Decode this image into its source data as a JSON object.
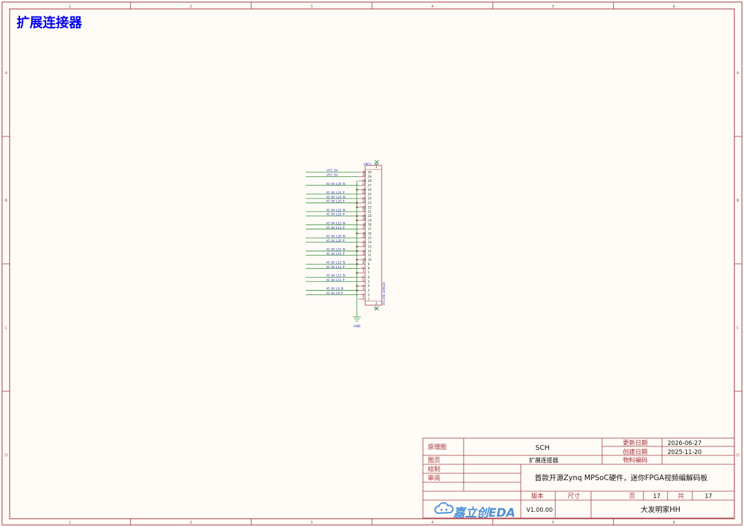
{
  "sheet_title": "扩展连接器",
  "border": {
    "columns": [
      "1",
      "2",
      "3",
      "4",
      "5",
      "6"
    ],
    "rows": [
      "A",
      "B",
      "C",
      "D"
    ]
  },
  "connector": {
    "designator": "FPC1",
    "part": "FPC-05F-30PH20",
    "end_pins": {
      "top": "31",
      "bottom": "32"
    },
    "ground_label": "GND",
    "left_pins": [
      "30",
      "28",
      "26",
      "24",
      "22",
      "20",
      "18",
      "16",
      "14",
      "12",
      "10",
      "8",
      "6",
      "4",
      "2"
    ],
    "right_pins": [
      "29",
      "27",
      "25",
      "23",
      "21",
      "19",
      "17",
      "15",
      "13",
      "11",
      "9",
      "7",
      "5",
      "3",
      "1"
    ],
    "inner_top": "1",
    "inner_bottom": "2",
    "gnd_pins": [
      "26",
      "23",
      "22",
      "20",
      "19",
      "16",
      "13",
      "12",
      "10",
      "9",
      "7",
      "4",
      "3"
    ],
    "nets": [
      {
        "name": "VCC_5V",
        "pin": "30"
      },
      {
        "name": "VCC_5V",
        "pin": "29"
      },
      {
        "name": "IO_S4_L24_N",
        "pin": "27"
      },
      {
        "name": "IO_S4_L24_P",
        "pin": "25"
      },
      {
        "name": "IO_S4_L23_N",
        "pin": "24"
      },
      {
        "name": "IO_S4_L23_P",
        "pin": "23"
      },
      {
        "name": "IO_S4_L22_N",
        "pin": "21"
      },
      {
        "name": "IO_S4_L22_P",
        "pin": "20"
      },
      {
        "name": "IO_S4_L13_N",
        "pin": "18"
      },
      {
        "name": "IO_S4_L13_P",
        "pin": "17"
      },
      {
        "name": "IO_S4_L20_N",
        "pin": "15"
      },
      {
        "name": "IO_S4_L20_P",
        "pin": "14"
      },
      {
        "name": "IO_S4_L15_N",
        "pin": "12"
      },
      {
        "name": "IO_S4_L15_P",
        "pin": "11"
      },
      {
        "name": "IO_S4_L12_N",
        "pin": "9"
      },
      {
        "name": "IO_S4_L12_P",
        "pin": "8"
      },
      {
        "name": "IO_S4_L11_N",
        "pin": "6"
      },
      {
        "name": "IO_S4_L11_P",
        "pin": "5"
      },
      {
        "name": "IO_S4_L9_N",
        "pin": "3"
      },
      {
        "name": "IO_S4_L9_P",
        "pin": "2"
      }
    ]
  },
  "title_block": {
    "doc_type_label": "原理图",
    "doc_type_value": "SCH",
    "updated_label": "更新日期",
    "updated_value": "2026-06-27",
    "created_label": "创建日期",
    "created_value": "2025-11-20",
    "page_label": "图页",
    "page_value": "扩展连接器",
    "bom_label": "物料编码",
    "bom_value": "",
    "drawn_label": "绘制",
    "review_label": "审阅",
    "project_title": "首款开源Zynq MPSoC硬件，迷你FPGA视频编解码板",
    "version_label": "版本",
    "size_label": "尺寸",
    "page_no_label": "页",
    "page_no_value": "17",
    "total_label": "共",
    "total_value": "17",
    "logo_text": "嘉立创EDA",
    "version_value": "V1.00.00",
    "author": "大发明家HH"
  },
  "colors": {
    "frame": "#a0303a",
    "wire": "#2a8a2a",
    "net_label": "#1a2aa8",
    "title": "#0000ee",
    "logo": "#4a8fd6",
    "background": "#fffcf7"
  }
}
